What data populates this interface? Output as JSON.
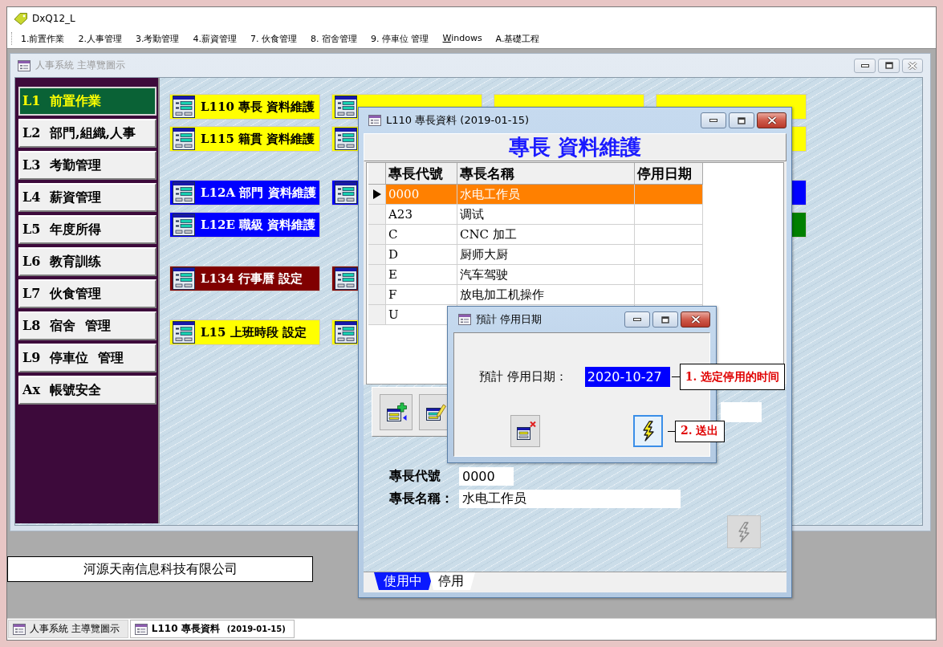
{
  "app": {
    "title": "DxQ12_L"
  },
  "menu": [
    {
      "label": "1.前置作業",
      "underline_first": false
    },
    {
      "label": "2.人事管理",
      "underline_first": false
    },
    {
      "label": "3.考勤管理",
      "underline_first": false
    },
    {
      "label": "4.薪資管理",
      "underline_first": false
    },
    {
      "label": "7. 伙食管理",
      "underline_first": false
    },
    {
      "label": "8. 宿舍管理",
      "underline_first": false
    },
    {
      "label": "9. 停車位 管理",
      "underline_first": false
    },
    {
      "label": "Windows",
      "underline_first": true
    },
    {
      "label": "A.基礎工程",
      "underline_first": false
    }
  ],
  "nav_window": {
    "title": "人事系統 主導覽圖示",
    "active": false,
    "sidebar": [
      {
        "label": "L1 前置作業",
        "selected": true
      },
      {
        "label": "L2 部門,組織,人事",
        "selected": false
      },
      {
        "label": "L3 考勤管理",
        "selected": false
      },
      {
        "label": "L4 薪資管理",
        "selected": false
      },
      {
        "label": "L5 年度所得",
        "selected": false
      },
      {
        "label": "L6 教育訓练",
        "selected": false
      },
      {
        "label": "L7 伙食管理",
        "selected": false
      },
      {
        "label": "L8 宿舍 管理",
        "selected": false
      },
      {
        "label": "L9 停車位 管理",
        "selected": false
      },
      {
        "label": "Ax 帳號安全",
        "selected": false
      }
    ],
    "tile_groups": [
      [
        {
          "column_1": {
            "label": "L110 專長 資料維護",
            "color": "#ffff00",
            "icon": true
          },
          "column_2": {
            "color": "#ffff00",
            "icon": true
          },
          "column_3": {
            "color": "#ffff00"
          },
          "column_4": {
            "color": "#ffff00"
          }
        },
        {
          "column_1": {
            "label": "L115 籍貫 資料維護",
            "color": "#ffff00",
            "icon": true
          },
          "column_2": {
            "color": "#ffff00",
            "icon": true
          },
          "column_4": {
            "color": "#ffff00"
          }
        }
      ],
      [
        {
          "column_1": {
            "label": "L12A 部門 資料維護",
            "color": "#0000ff",
            "icon": true
          },
          "column_2": {
            "color": "#0000ff",
            "icon": true
          },
          "column_4": {
            "color": "#0000ff"
          }
        },
        {
          "column_1": {
            "label": "L12E 職級 資料維護",
            "color": "#0000ff",
            "icon": true
          },
          "column_4": {
            "color": "#008000"
          }
        }
      ],
      [
        {
          "column_1": {
            "label": "L134 行事曆 設定",
            "color": "#800000",
            "icon": true
          },
          "column_2": {
            "color": "#800000",
            "icon": true
          }
        }
      ],
      [
        {
          "column_1": {
            "label": "L15 上班時段 設定",
            "color": "#ffff00",
            "icon": true
          },
          "column_2": {
            "color": "#ffff00",
            "icon": true
          }
        }
      ]
    ]
  },
  "editor_window": {
    "title": "L110 專長資料 (2019-01-15)",
    "active": true,
    "heading": "專長 資料維護",
    "grid": {
      "columns": [
        "專長代號",
        "專長名稱",
        "停用日期"
      ],
      "rows": [
        {
          "code": "0000",
          "name": "水电工作员",
          "selected": true
        },
        {
          "code": "A23",
          "name": "调试",
          "selected": false
        },
        {
          "code": "C",
          "name": "CNC 加工",
          "selected": false
        },
        {
          "code": "D",
          "name": "厨师大厨",
          "selected": false
        },
        {
          "code": "E",
          "name": "汽车驾驶",
          "selected": false
        },
        {
          "code": "F",
          "name": "放电加工机操作",
          "selected": false
        },
        {
          "code": "U",
          "selected": false
        }
      ]
    },
    "toolbar": [
      {
        "kind": "add"
      },
      {
        "kind": "edit"
      }
    ],
    "fields": [
      {
        "label": "專長代號",
        "value": "0000"
      },
      {
        "label": "專長名稱：",
        "value": "水电工作员"
      }
    ],
    "send_button": {
      "disabled": true
    },
    "tabs": [
      {
        "label": "使用中",
        "selected": true
      },
      {
        "label": "停用",
        "selected": false
      }
    ]
  },
  "date_dialog": {
    "title": "預計 停用日期",
    "active": true,
    "label": "預計 停用日期：",
    "value": "2020-10-27",
    "value_selected": true,
    "buttons": [
      {
        "kind": "cancel",
        "focused": false
      },
      {
        "kind": "send",
        "focused": true
      }
    ]
  },
  "annotations": [
    {
      "label": "1. 选定停用的时间"
    },
    {
      "label": "2. 送出"
    }
  ],
  "company": "河源天南信息科技有限公司",
  "taskbar": [
    {
      "label": "人事系統 主導覽圖示",
      "selected": false
    },
    {
      "label": "L110 專長資料",
      "note": "(2019-01-15)",
      "selected": true
    }
  ]
}
